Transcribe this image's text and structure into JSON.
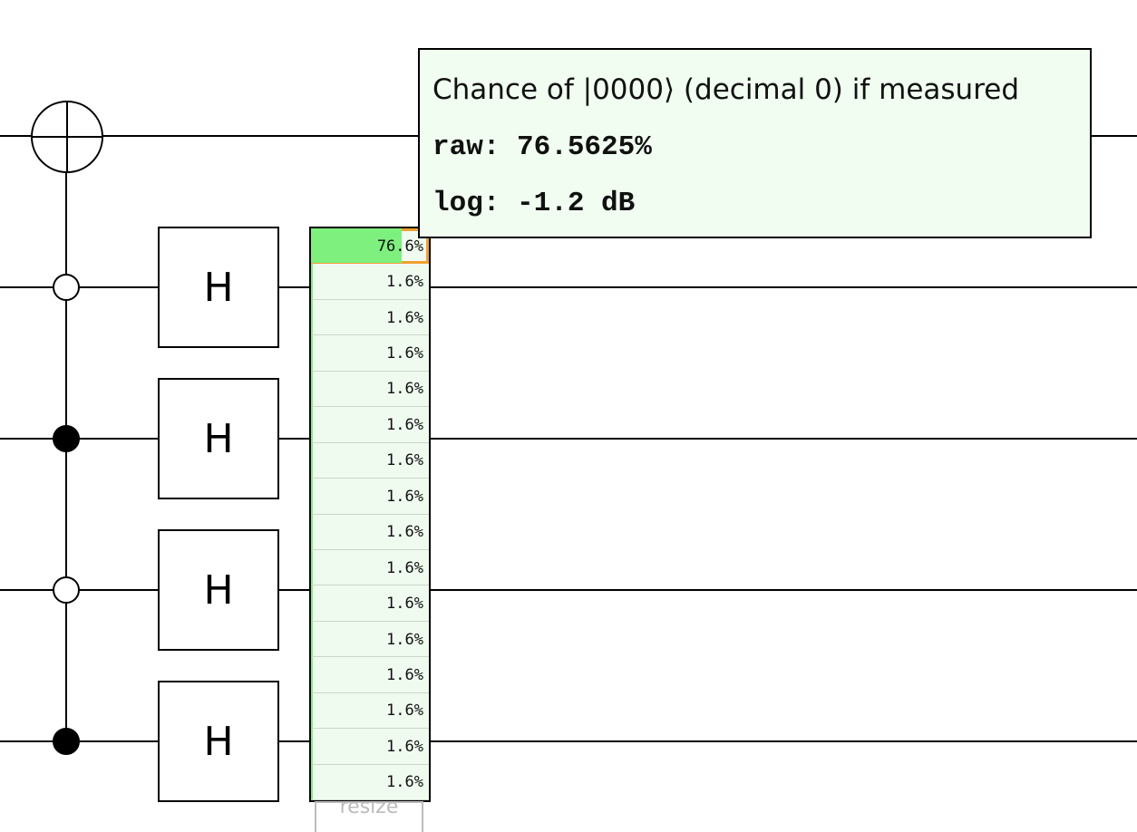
{
  "circuit": {
    "gates": [
      "H",
      "H",
      "H",
      "H"
    ],
    "controls": [
      {
        "wire": 1,
        "type": "anti-control (open circle)"
      },
      {
        "wire": 2,
        "type": "control (filled)"
      },
      {
        "wire": 3,
        "type": "anti-control (open circle)"
      },
      {
        "wire": 4,
        "type": "control (filled)"
      }
    ],
    "target": {
      "wire": 0,
      "type": "x-target (circle-plus)"
    }
  },
  "probability_display": {
    "highlighted_index": 0,
    "fill_color": "#7df07d",
    "background_color": "#f0fbf0",
    "highlight_color": "#f0a030",
    "cells": [
      {
        "label": "76.6%",
        "value": 76.5625
      },
      {
        "label": "1.6%",
        "value": 1.5625
      },
      {
        "label": "1.6%",
        "value": 1.5625
      },
      {
        "label": "1.6%",
        "value": 1.5625
      },
      {
        "label": "1.6%",
        "value": 1.5625
      },
      {
        "label": "1.6%",
        "value": 1.5625
      },
      {
        "label": "1.6%",
        "value": 1.5625
      },
      {
        "label": "1.6%",
        "value": 1.5625
      },
      {
        "label": "1.6%",
        "value": 1.5625
      },
      {
        "label": "1.6%",
        "value": 1.5625
      },
      {
        "label": "1.6%",
        "value": 1.5625
      },
      {
        "label": "1.6%",
        "value": 1.5625
      },
      {
        "label": "1.6%",
        "value": 1.5625
      },
      {
        "label": "1.6%",
        "value": 1.5625
      },
      {
        "label": "1.6%",
        "value": 1.5625
      },
      {
        "label": "1.6%",
        "value": 1.5625
      }
    ],
    "resize_label": "resize"
  },
  "tooltip": {
    "title": "Chance of |0000⟩ (decimal 0) if measured",
    "raw": "raw: 76.5625%",
    "log": "log: -1.2 dB"
  }
}
